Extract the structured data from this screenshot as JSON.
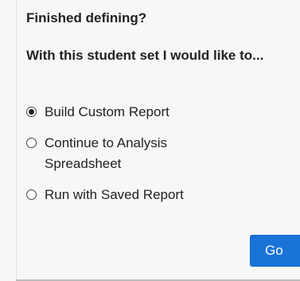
{
  "panel": {
    "heading": "Finished defining?",
    "prompt": "With this student set I would like to...",
    "options": [
      {
        "label": "Build Custom Report",
        "selected": true
      },
      {
        "label": "Continue to Analysis Spreadsheet",
        "selected": false
      },
      {
        "label": "Run with Saved Report",
        "selected": false
      }
    ],
    "go_label": "Go",
    "accent_color": "#1a73d9"
  }
}
